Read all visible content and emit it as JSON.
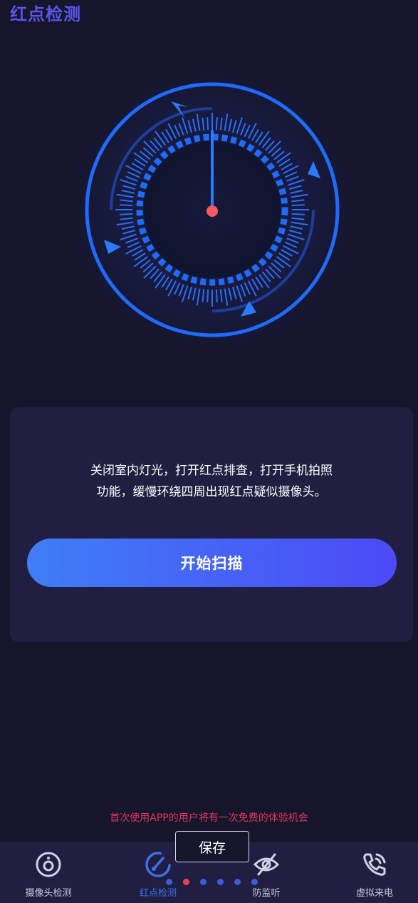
{
  "header": {
    "title": "红点检测"
  },
  "radar": {
    "ring_color": "#1f6bff",
    "needle_color": "#2a7bff",
    "center_dot_color": "#ff5a5f"
  },
  "card": {
    "line1": "关闭室内灯光，打开红点排查，打开手机拍照",
    "line2": "功能，缓慢环绕四周出现红点疑似摄像头。",
    "start_button": "开始扫描"
  },
  "notice": "首次使用APP的用户将有一次免费的体验机会",
  "save_button": "保存",
  "pager": {
    "count": 6,
    "active_index": 1
  },
  "nav": {
    "items": [
      {
        "label": "摄像头检测",
        "icon": "camera-lens-icon"
      },
      {
        "label": "红点检测",
        "icon": "speedometer-icon",
        "active": true
      },
      {
        "label": "防监听",
        "icon": "ear-off-icon"
      },
      {
        "label": "虚拟来电",
        "icon": "phone-call-icon"
      }
    ]
  }
}
